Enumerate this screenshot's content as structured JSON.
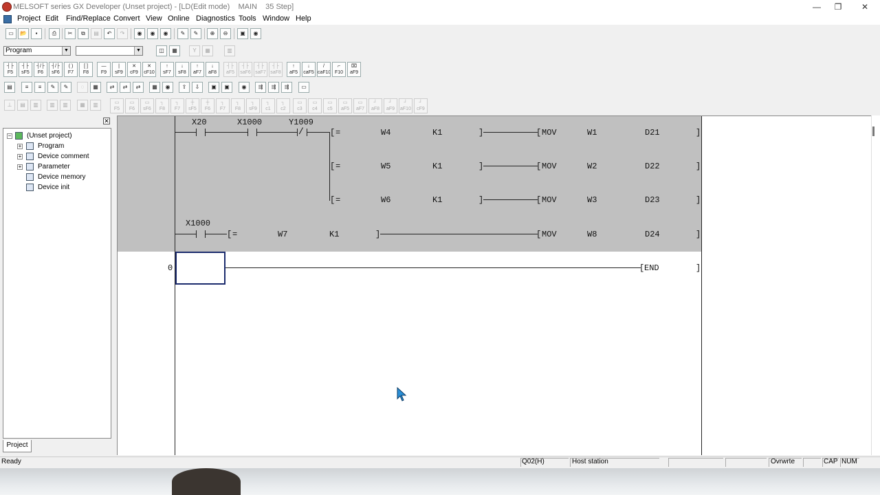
{
  "window": {
    "title": "MELSOFT series GX Developer (Unset project) - [LD(Edit mode)    MAIN    35 Step]",
    "controls": [
      "—",
      "❐",
      "✕"
    ]
  },
  "menu": [
    "Project",
    "Edit",
    "Find/Replace",
    "Convert",
    "View",
    "Online",
    "Diagnostics",
    "Tools",
    "Window",
    "Help"
  ],
  "toolbar": {
    "program_combo": "Program",
    "second_combo": "",
    "ladder_keys": [
      "F5",
      "sF5",
      "F6",
      "sF6",
      "F7",
      "F8",
      "F9",
      "sF9",
      "cF9",
      "cF10",
      "sF7",
      "sF8",
      "aF7",
      "aF8",
      "aF5",
      "caF5",
      "caF10",
      "F10",
      "aF9"
    ],
    "ladder_keys_disabled": [
      "aF5",
      "saF6",
      "saF7",
      "saF8"
    ],
    "sfc_keys": [
      "F5",
      "F6",
      "sF6",
      "F8",
      "F7",
      "sF5",
      "F6",
      "F7",
      "F8",
      "sF9",
      "c1",
      "c2",
      "c3",
      "c4",
      "c5",
      "aF5",
      "aF7",
      "aF8",
      "aF9",
      "aF10",
      "cF9"
    ]
  },
  "project_tree": {
    "root": "(Unset project)",
    "items": [
      "Program",
      "Device comment",
      "Parameter",
      "Device memory",
      "Device init"
    ],
    "tab": "Project"
  },
  "ladder": {
    "rung1_contacts": [
      "X20",
      "X1000",
      "Y1009"
    ],
    "compare_rows": [
      {
        "op": "=",
        "a": "W4",
        "b": "K1",
        "inst": "MOV",
        "src": "W1",
        "dst": "D21"
      },
      {
        "op": "=",
        "a": "W5",
        "b": "K1",
        "inst": "MOV",
        "src": "W2",
        "dst": "D22"
      },
      {
        "op": "=",
        "a": "W6",
        "b": "K1",
        "inst": "MOV",
        "src": "W3",
        "dst": "D23"
      }
    ],
    "rung2": {
      "contact": "X1000",
      "op": "=",
      "a": "W7",
      "b": "K1",
      "inst": "MOV",
      "src": "W8",
      "dst": "D24"
    },
    "end_step": "0",
    "end_label": "END"
  },
  "status": {
    "ready": "Ready",
    "cpu": "Q02(H)",
    "station": "Host station",
    "mode": "Ovrwrte",
    "caps": "CAP",
    "num": "NUM"
  }
}
